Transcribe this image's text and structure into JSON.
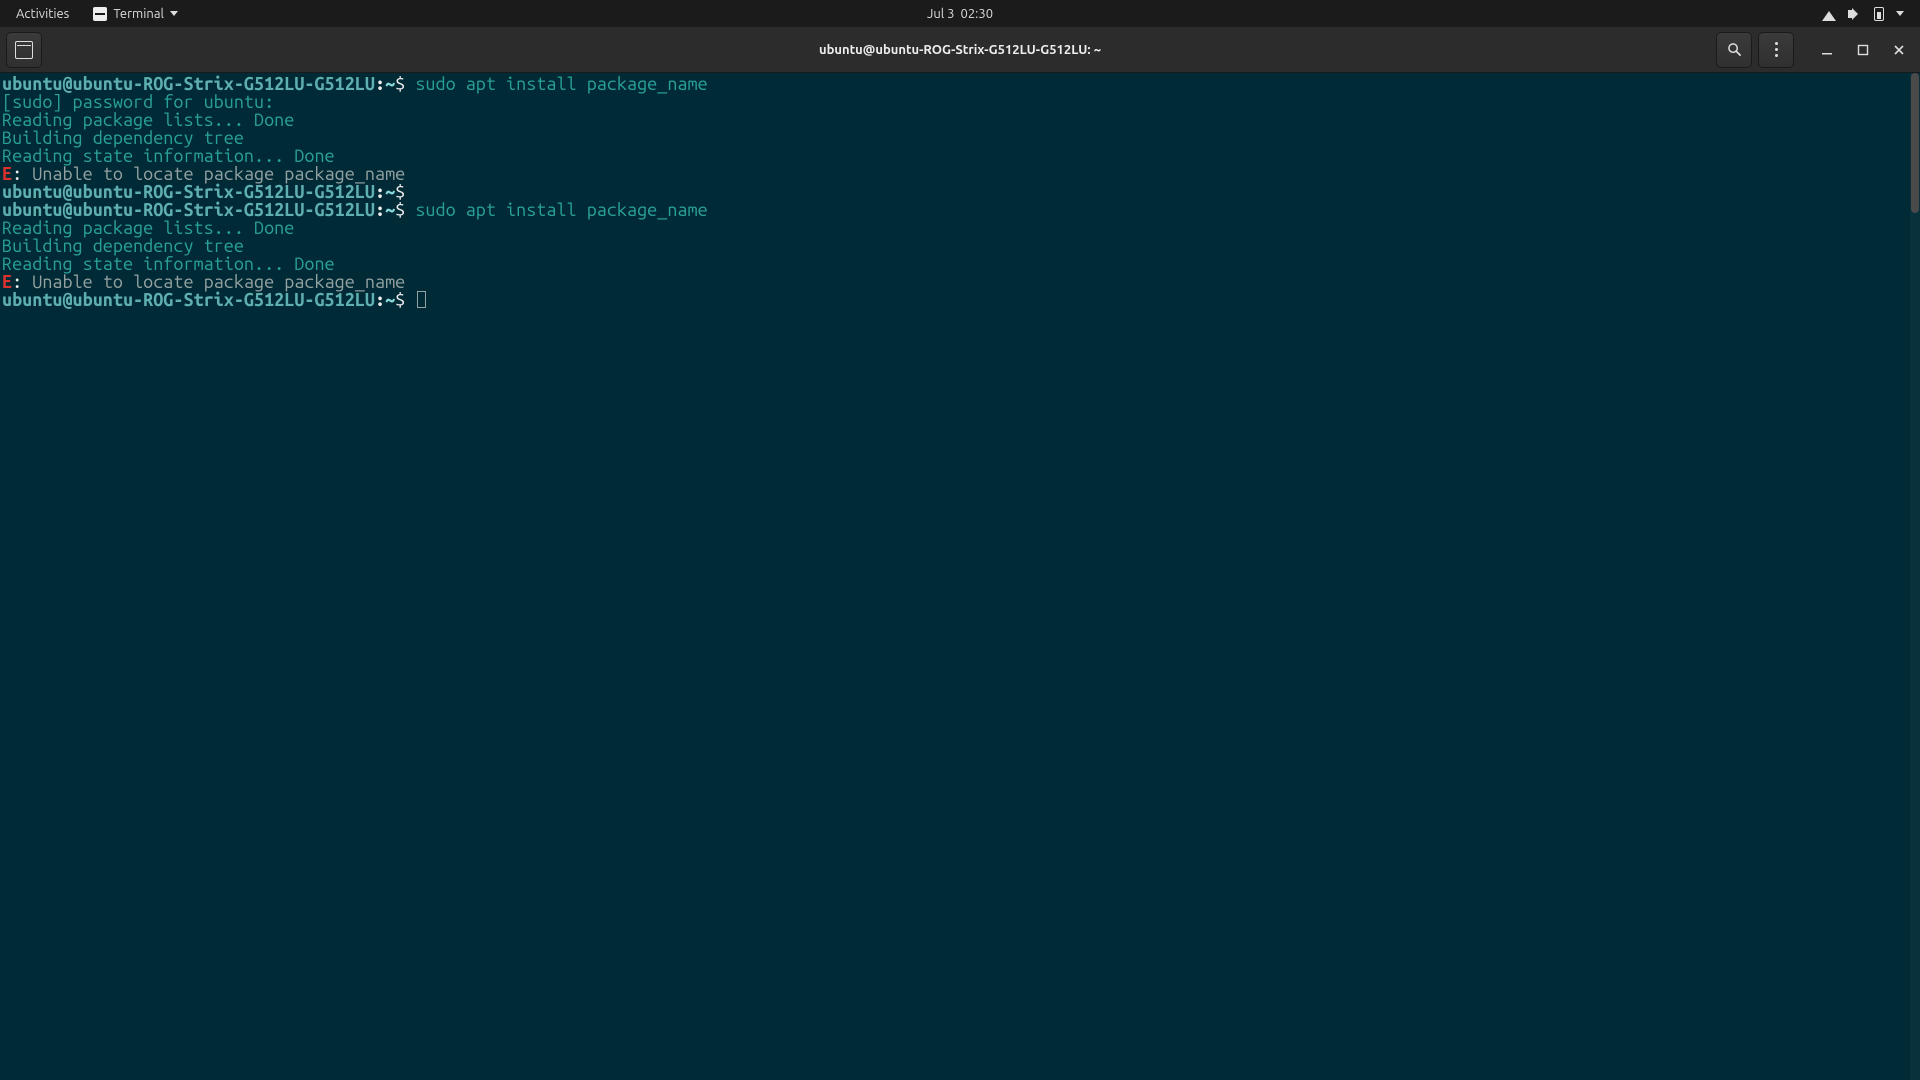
{
  "topbar": {
    "activities": "Activities",
    "app_menu": "Terminal",
    "clock_date": "Jul 3",
    "clock_time": "02:30"
  },
  "headerbar": {
    "title": "ubuntu@ubuntu-ROG-Strix-G512LU-G512LU: ~"
  },
  "term": {
    "prompt_user_host": "ubuntu@ubuntu-ROG-Strix-G512LU-G512LU",
    "prompt_sep": ":",
    "prompt_path": "~",
    "prompt_symbol": "$",
    "lines": {
      "cmd1": " sudo apt install package_name",
      "l1": "[sudo] password for ubuntu: ",
      "l2": "Reading package lists... Done",
      "l3": "Building dependency tree       ",
      "l4": "Reading state information... Done",
      "err_tag": "E",
      "err_sep": ": ",
      "err_body": "Unable to locate package package_name",
      "cmd2_blank": " ",
      "cmd3": " sudo apt install package_name",
      "l5": "Reading package lists... Done",
      "l6": "Building dependency tree       ",
      "l7": "Reading state information... Done"
    }
  }
}
